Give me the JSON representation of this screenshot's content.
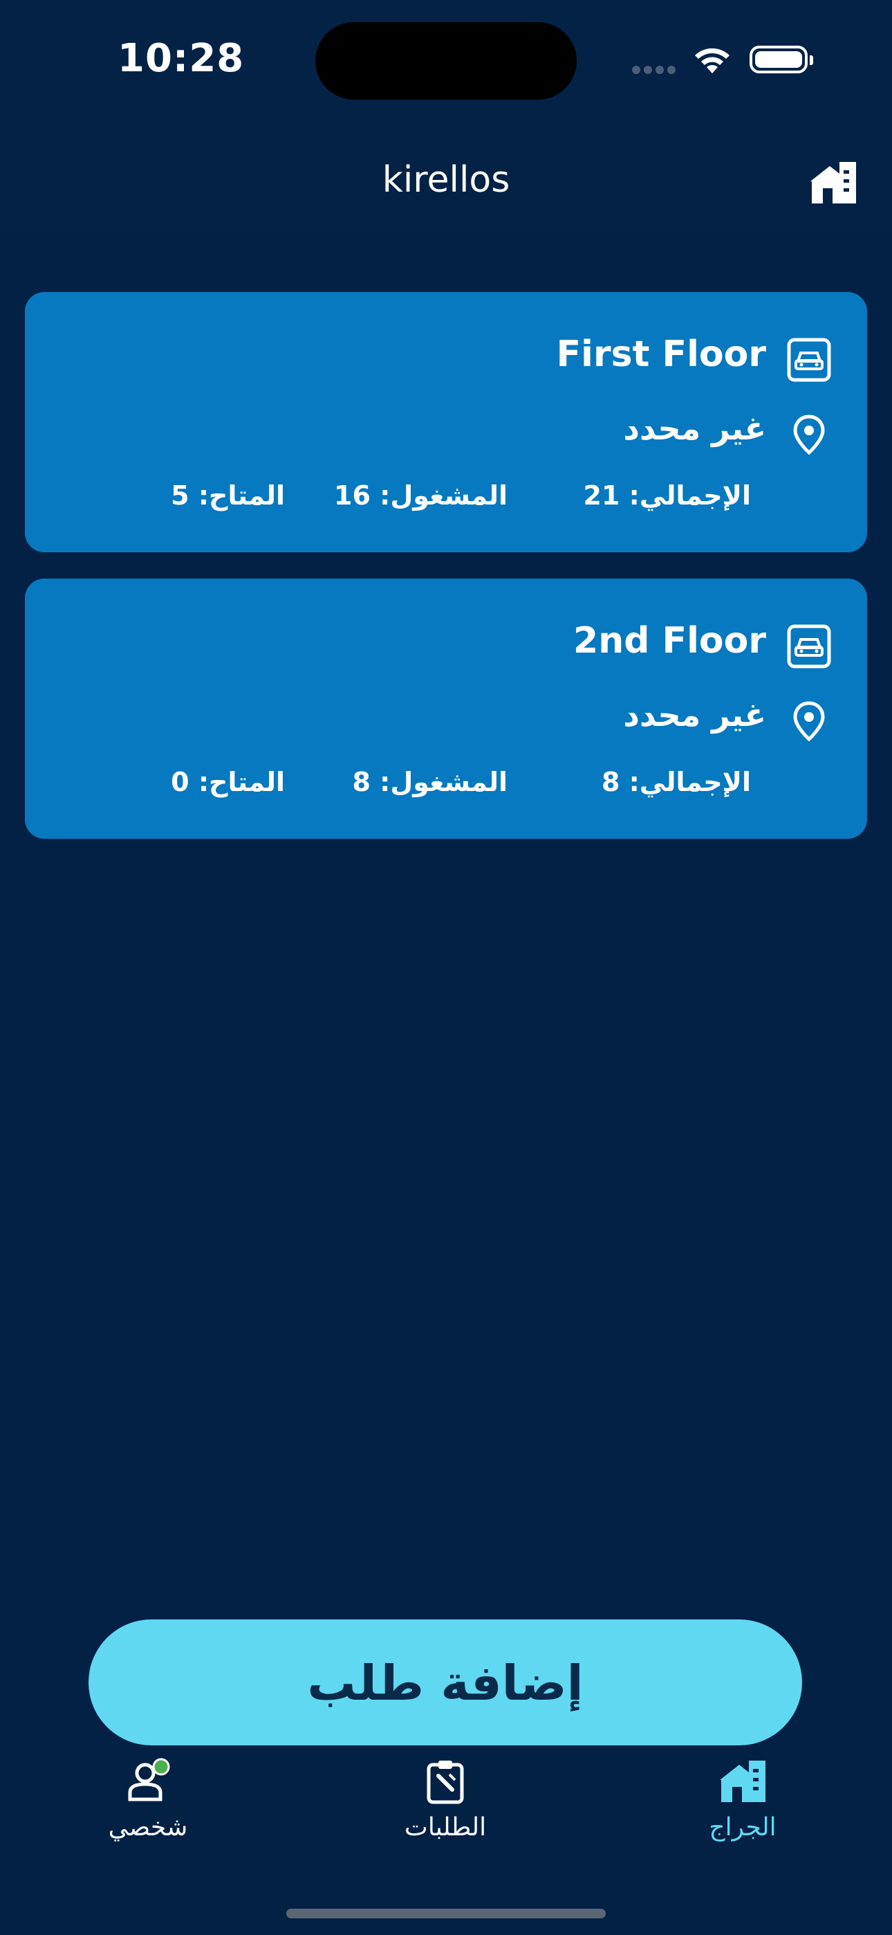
{
  "status_bar": {
    "time": "10:28"
  },
  "header": {
    "title": "kirellos",
    "home_icon": "garage-home-icon"
  },
  "floors": [
    {
      "name": "First Floor",
      "location": "غير محدد",
      "total": "الإجمالي: 21",
      "occupied": "المشغول: 16",
      "available": "المتاح: 5"
    },
    {
      "name": "2nd Floor",
      "location": "غير محدد",
      "total": "الإجمالي: 8",
      "occupied": "المشغول: 8",
      "available": "المتاح: 0"
    }
  ],
  "add_button": {
    "label": "إضافة طلب"
  },
  "nav": {
    "profile": {
      "label": "شخصي",
      "icon": "user-icon"
    },
    "requests": {
      "label": "الطلبات",
      "icon": "clipboard-icon"
    },
    "garage": {
      "label": "الجراج",
      "icon": "garage-icon"
    }
  },
  "colors": {
    "background": "#032144",
    "card": "#0679c0",
    "accent": "#60d8f2",
    "online_dot": "#4caf50"
  }
}
